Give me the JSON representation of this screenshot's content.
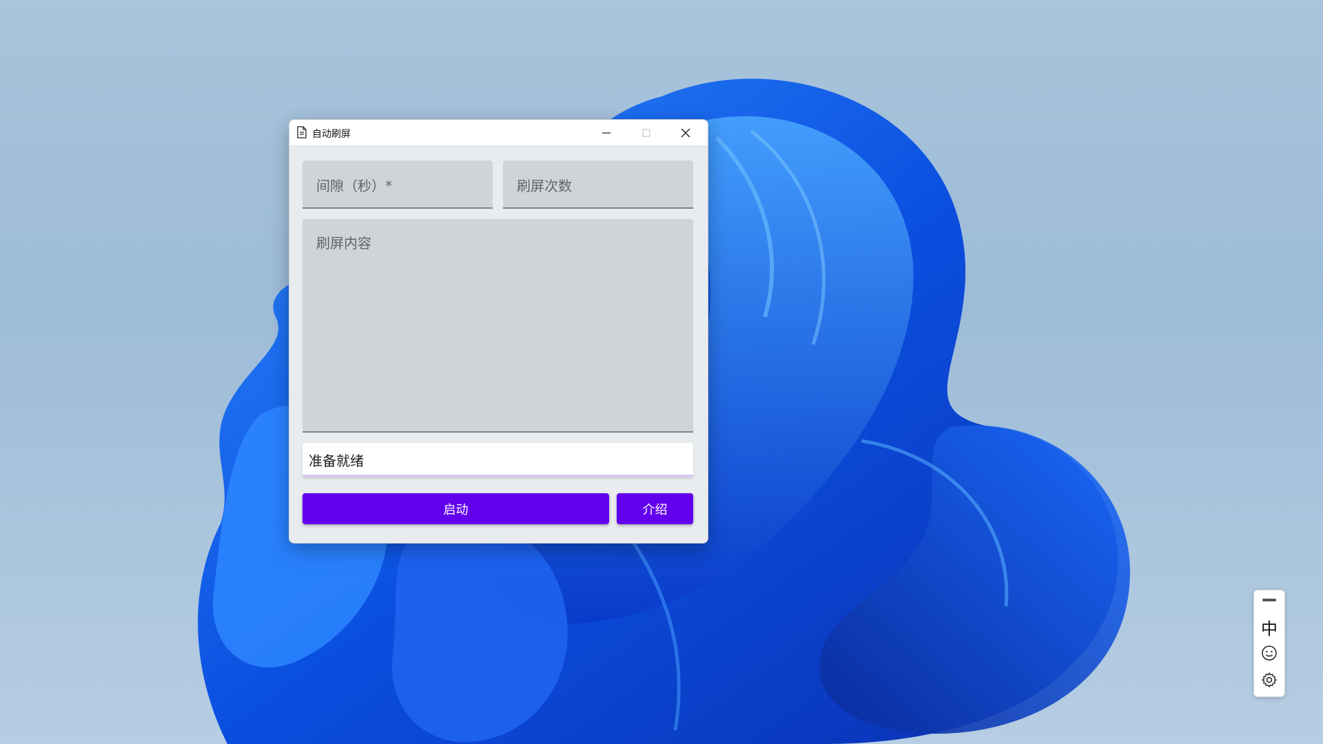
{
  "window": {
    "title": "自动刷屏",
    "icon": "document-icon"
  },
  "form": {
    "interval_placeholder": "间隙（秒）*",
    "count_placeholder": "刷屏次数",
    "content_placeholder": "刷屏内容",
    "status_text": "准备就绪"
  },
  "buttons": {
    "start_label": "启动",
    "intro_label": "介绍"
  },
  "ime_toolbar": {
    "language_label": "中",
    "icons": [
      "drag-handle-icon",
      "emoji-icon",
      "settings-icon"
    ]
  },
  "colors": {
    "accent": "#6200ee",
    "field_bg": "#cfd4d8",
    "window_bg": "#e8ecef"
  }
}
